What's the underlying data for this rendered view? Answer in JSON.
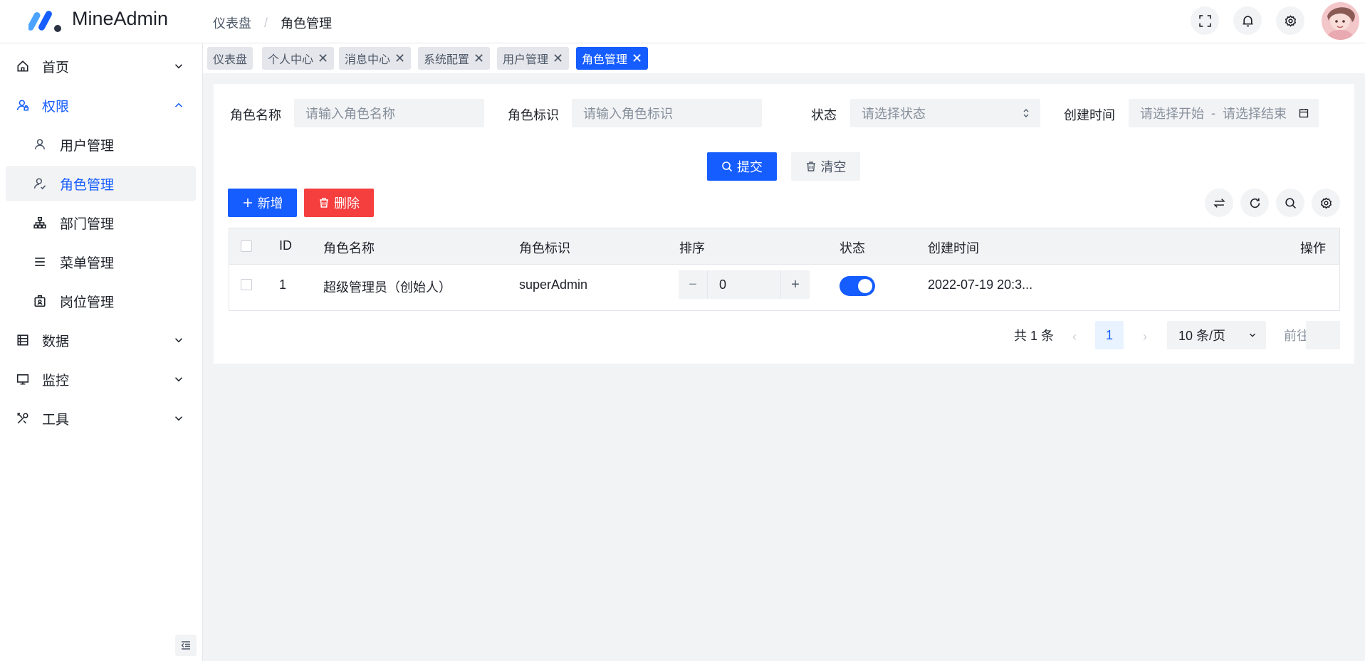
{
  "app": {
    "title": "MineAdmin"
  },
  "breadcrumb": {
    "parent": "仪表盘",
    "separator": "/",
    "current": "角色管理"
  },
  "header_actions": [
    "fullscreen-icon",
    "bell-icon",
    "gear-icon"
  ],
  "sidebar": {
    "items": [
      {
        "label": "首页",
        "icon": "home-icon",
        "expanded": false
      },
      {
        "label": "权限",
        "icon": "user-lock-icon",
        "expanded": true
      },
      {
        "label": "用户管理",
        "icon": "user-icon",
        "sub": true
      },
      {
        "label": "角色管理",
        "icon": "user-role-icon",
        "sub": true,
        "active": true
      },
      {
        "label": "部门管理",
        "icon": "org-chart-icon",
        "sub": true
      },
      {
        "label": "菜单管理",
        "icon": "menu-list-icon",
        "sub": true
      },
      {
        "label": "岗位管理",
        "icon": "badge-icon",
        "sub": true
      },
      {
        "label": "数据",
        "icon": "database-icon",
        "expanded": false
      },
      {
        "label": "监控",
        "icon": "monitor-icon",
        "expanded": false
      },
      {
        "label": "工具",
        "icon": "tools-icon",
        "expanded": false
      }
    ]
  },
  "tabs": [
    {
      "label": "仪表盘",
      "closable": false
    },
    {
      "label": "个人中心",
      "closable": true
    },
    {
      "label": "消息中心",
      "closable": true
    },
    {
      "label": "系统配置",
      "closable": true
    },
    {
      "label": "用户管理",
      "closable": true
    },
    {
      "label": "角色管理",
      "closable": true,
      "active": true
    }
  ],
  "tab_close_glyph": "✕",
  "search": {
    "role_name_label": "角色名称",
    "role_name_placeholder": "请输入角色名称",
    "role_code_label": "角色标识",
    "role_code_placeholder": "请输入角色标识",
    "status_label": "状态",
    "status_placeholder": "请选择状态",
    "created_label": "创建时间",
    "created_start_placeholder": "请选择开始",
    "created_range_sep": "-",
    "created_end_placeholder": "请选择结束",
    "submit_label": "提交",
    "clear_label": "清空"
  },
  "toolbar": {
    "add_label": "新增",
    "delete_label": "删除"
  },
  "table": {
    "columns": [
      "ID",
      "角色名称",
      "角色标识",
      "排序",
      "状态",
      "创建时间",
      "操作"
    ],
    "rows": [
      {
        "id": "1",
        "name": "超级管理员（创始人）",
        "code": "superAdmin",
        "sort": "0",
        "status_on": true,
        "created": "2022-07-19 20:3..."
      }
    ]
  },
  "stepper": {
    "minus": "−",
    "plus": "+"
  },
  "pagination": {
    "total": "共 1 条",
    "prev": "‹",
    "next": "›",
    "current_page": "1",
    "page_size": "10 条/页",
    "jump_label": "前往"
  },
  "colors": {
    "primary": "#165dff",
    "danger": "#f53f3f",
    "muted_bg": "#f2f3f5"
  }
}
